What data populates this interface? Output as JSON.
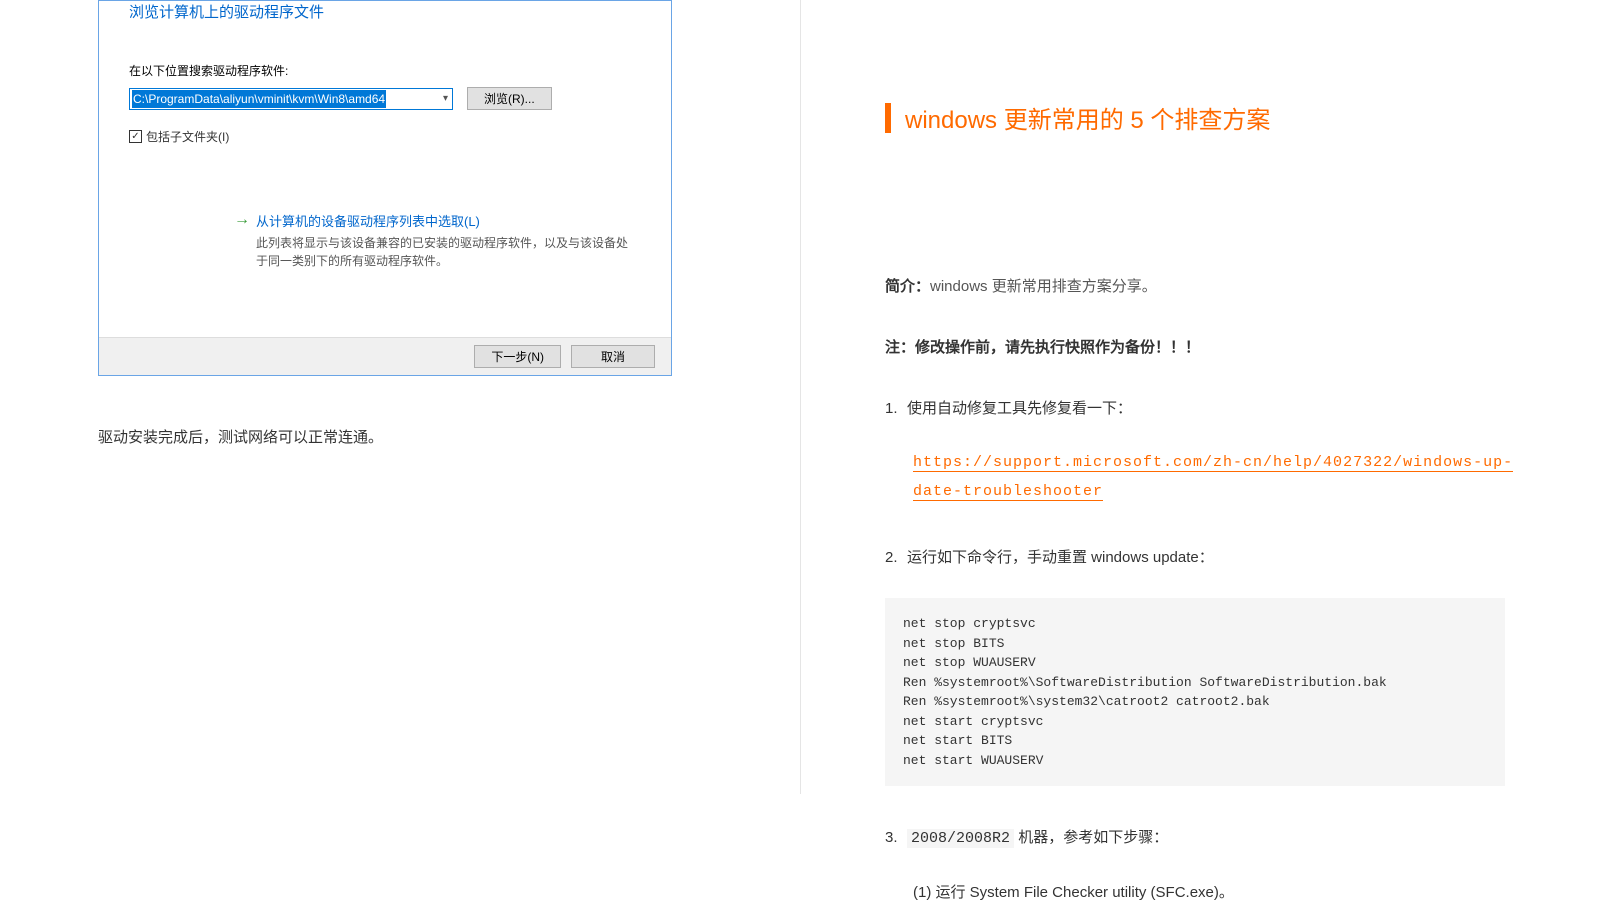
{
  "left": {
    "dialog": {
      "title": "浏览计算机上的驱动程序文件",
      "search_label": "在以下位置搜索驱动程序软件:",
      "path": "C:\\ProgramData\\aliyun\\vminit\\kvm\\Win8\\amd64",
      "browse_btn": "浏览(R)...",
      "include_sub": "包括子文件夹(I)",
      "pick_title": "从计算机的设备驱动程序列表中选取(L)",
      "pick_desc": "此列表将显示与该设备兼容的已安装的驱动程序软件，以及与该设备处于同一类别下的所有驱动程序软件。",
      "next_btn": "下一步(N)",
      "cancel_btn": "取消"
    },
    "caption": "驱动安装完成后，测试网络可以正常连通。"
  },
  "right": {
    "heading": "windows 更新常用的 5 个排查方案",
    "intro_label": "简介：",
    "intro_text": "windows 更新常用排查方案分享。",
    "note": "注：修改操作前，请先执行快照作为备份！！！",
    "item1": "使用自动修复工具先修复看一下：",
    "link_line1": "https://support.microsoft.com/zh-cn/help/4027322/windows-up-",
    "link_line2": "date-troubleshooter",
    "item2": "运行如下命令行，手动重置 windows update：",
    "code": "net stop cryptsvc\nnet stop BITS\nnet stop WUAUSERV\nRen %systemroot%\\SoftwareDistribution SoftwareDistribution.bak\nRen %systemroot%\\system32\\catroot2 catroot2.bak\nnet start cryptsvc\nnet start BITS\nnet start WUAUSERV",
    "item3_pre": "2008/2008R2",
    "item3_post": " 机器，参考如下步骤：",
    "sub1": "(1) 运行 System File Checker utility (SFC.exe)。"
  }
}
